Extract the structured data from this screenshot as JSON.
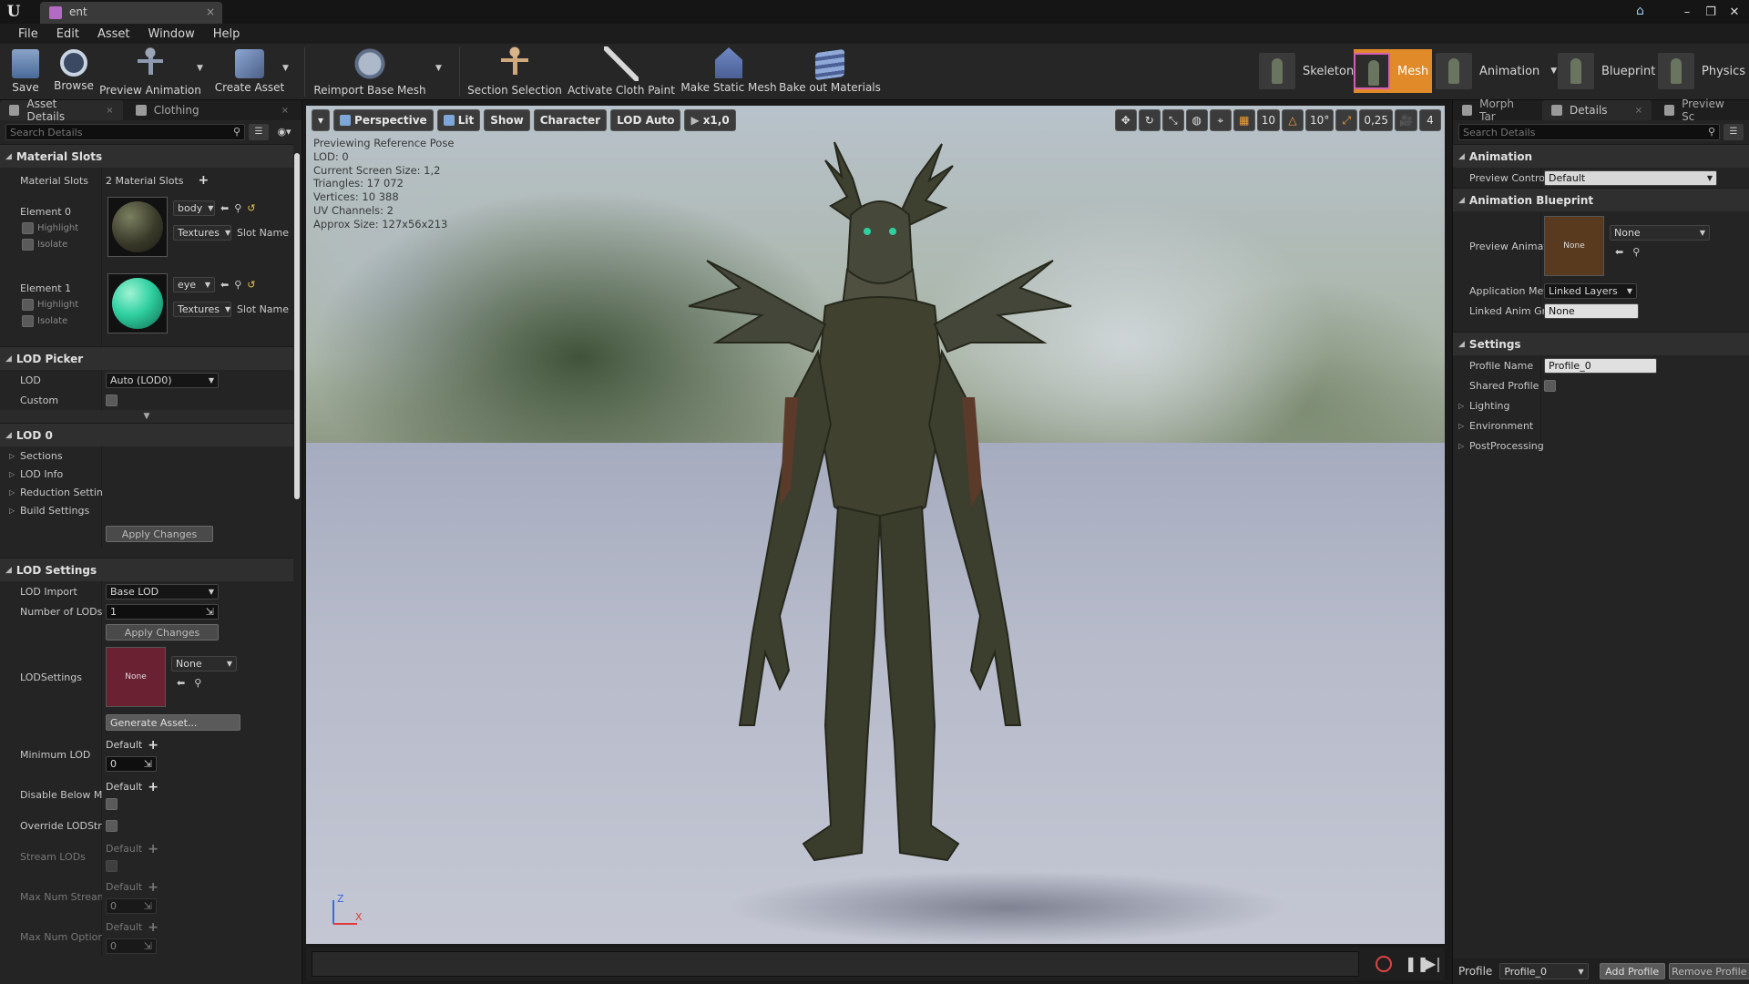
{
  "window": {
    "tab_title": "ent"
  },
  "menu": [
    "File",
    "Edit",
    "Asset",
    "Window",
    "Help"
  ],
  "toolbar": {
    "save": "Save",
    "browse": "Browse",
    "preview_animation": "Preview Animation",
    "create_asset": "Create Asset",
    "reimport_base_mesh": "Reimport Base Mesh",
    "section_selection": "Section Selection",
    "activate_cloth_paint": "Activate Cloth Paint",
    "make_static_mesh": "Make Static Mesh",
    "bake_out_materials": "Bake out Materials"
  },
  "modes": {
    "skeleton": "Skeleton",
    "mesh": "Mesh",
    "animation": "Animation",
    "blueprint": "Blueprint",
    "physics": "Physics"
  },
  "left": {
    "tabs": {
      "asset_details": "Asset Details",
      "clothing": "Clothing"
    },
    "search_placeholder": "Search Details",
    "material_slots": {
      "header": "Material Slots",
      "label": "Material Slots",
      "value": "2 Material Slots",
      "elements": [
        {
          "label": "Element 0",
          "slot": "body",
          "textures": "Textures",
          "highlight": "Highlight",
          "isolate": "Isolate",
          "slot_name": "Slot Name"
        },
        {
          "label": "Element 1",
          "slot": "eye",
          "textures": "Textures",
          "highlight": "Highlight",
          "isolate": "Isolate",
          "slot_name": "Slot Name"
        }
      ]
    },
    "lod_picker": {
      "header": "LOD Picker",
      "lod_label": "LOD",
      "lod_value": "Auto (LOD0)",
      "custom_label": "Custom"
    },
    "lod0": {
      "header": "LOD 0",
      "sections": "Sections",
      "lod_info": "LOD Info",
      "reduction_settings": "Reduction Settings",
      "build_settings": "Build Settings",
      "apply_changes": "Apply Changes"
    },
    "lod_settings": {
      "header": "LOD Settings",
      "lod_import_label": "LOD Import",
      "lod_import_value": "Base LOD",
      "num_lods_label": "Number of LODs",
      "num_lods_value": "1",
      "apply_changes": "Apply Changes",
      "lodsettings_label": "LODSettings",
      "lodsettings_thumb": "None",
      "lodsettings_combo": "None",
      "generate_asset": "Generate Asset...",
      "min_lod_label": "Minimum LOD",
      "default": "Default",
      "min_lod_value": "0",
      "disable_below_label": "Disable Below Min LOD",
      "override_label": "Override LODStreaming",
      "stream_lods_label": "Stream LODs",
      "max_num_streamed_label": "Max Num Streamed LODs",
      "max_num_streamed_value": "0",
      "max_num_optional_label": "Max Num Optional LODs",
      "max_num_optional_value": "0"
    }
  },
  "viewport": {
    "buttons": {
      "perspective": "Perspective",
      "lit": "Lit",
      "show": "Show",
      "character": "Character",
      "lod_auto": "LOD Auto",
      "speed": "x1,0"
    },
    "right_values": {
      "grid": "10",
      "angle": "10°",
      "scale": "0,25",
      "camera": "4"
    },
    "info": [
      "Previewing Reference Pose",
      "LOD: 0",
      "Current Screen Size: 1,2",
      "Triangles: 17 072",
      "Vertices: 10 388",
      "UV Channels: 2",
      "Approx Size: 127x56x213"
    ],
    "axis": {
      "z": "Z",
      "x": "X"
    }
  },
  "right": {
    "tabs": {
      "morph": "Morph Tar",
      "details": "Details",
      "preview": "Preview Sc"
    },
    "search_placeholder": "Search Details",
    "animation": {
      "header": "Animation",
      "preview_controller_label": "Preview Controller",
      "preview_controller_value": "Default"
    },
    "anim_blueprint": {
      "header": "Animation Blueprint",
      "preview_anim_label": "Preview Animation",
      "thumb": "None",
      "combo": "None",
      "application_method_label": "Application Method",
      "application_method_value": "Linked Layers",
      "linked_anim_label": "Linked Anim Graph",
      "linked_anim_value": "None"
    },
    "settings": {
      "header": "Settings",
      "profile_name_label": "Profile Name",
      "profile_name_value": "Profile_0",
      "shared_profile_label": "Shared Profile",
      "lighting": "Lighting",
      "environment": "Environment",
      "postprocessing": "PostProcessing"
    },
    "footer": {
      "profile_label": "Profile",
      "profile_value": "Profile_0",
      "add_profile": "Add Profile",
      "remove_profile": "Remove Profile"
    }
  },
  "colors": {
    "accent_orange": "#e08a2a",
    "mesh_pink": "#d45fb3",
    "eye_green": "#2fd0a0",
    "thumb_maroon": "#6a2233",
    "thumb_brown": "#5a3a1e"
  }
}
